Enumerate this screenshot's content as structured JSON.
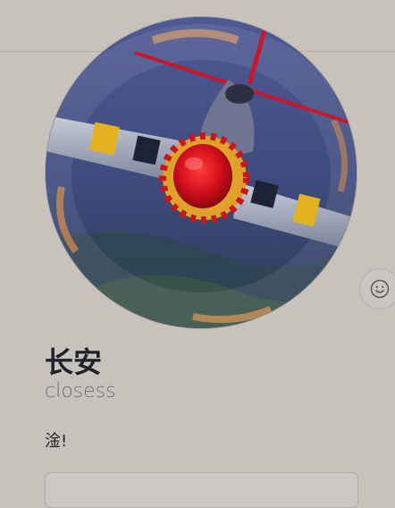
{
  "profile": {
    "display_name": "长安",
    "username": "closess",
    "bio": "淦!"
  },
  "status_button": {
    "icon": "smiley-icon"
  },
  "colors": {
    "page_background": "#c8c2bd",
    "divider": "#b4aea9",
    "name_text": "#1f2328",
    "username_text": "#6e7074"
  }
}
